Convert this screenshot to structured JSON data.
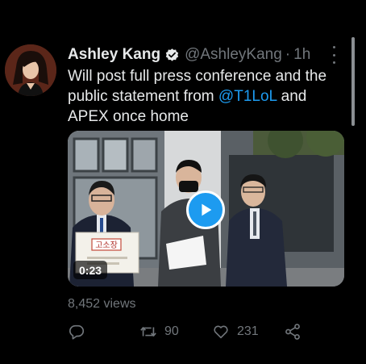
{
  "tweet": {
    "author": {
      "name": "Ashley Kang",
      "handle": "@AshleyKang",
      "separator": "·",
      "time": "1h",
      "verified": true
    },
    "text_parts": {
      "before": "Will post full press conference and the public statement from ",
      "mention": "@T1LoL",
      "after": " and APEX once home"
    },
    "media": {
      "type": "video",
      "duration": "0:23",
      "sign_text": "고소장"
    },
    "views": "8,452 views",
    "actions": {
      "reply_count": "",
      "retweet_count": "90",
      "like_count": "231"
    }
  },
  "colors": {
    "background": "#000000",
    "text": "#e7e9ea",
    "secondary": "#71767b",
    "accent": "#1d9bf0"
  },
  "icons": [
    "verified-icon",
    "more-icon",
    "play-icon",
    "reply-icon",
    "retweet-icon",
    "like-icon",
    "share-icon"
  ]
}
